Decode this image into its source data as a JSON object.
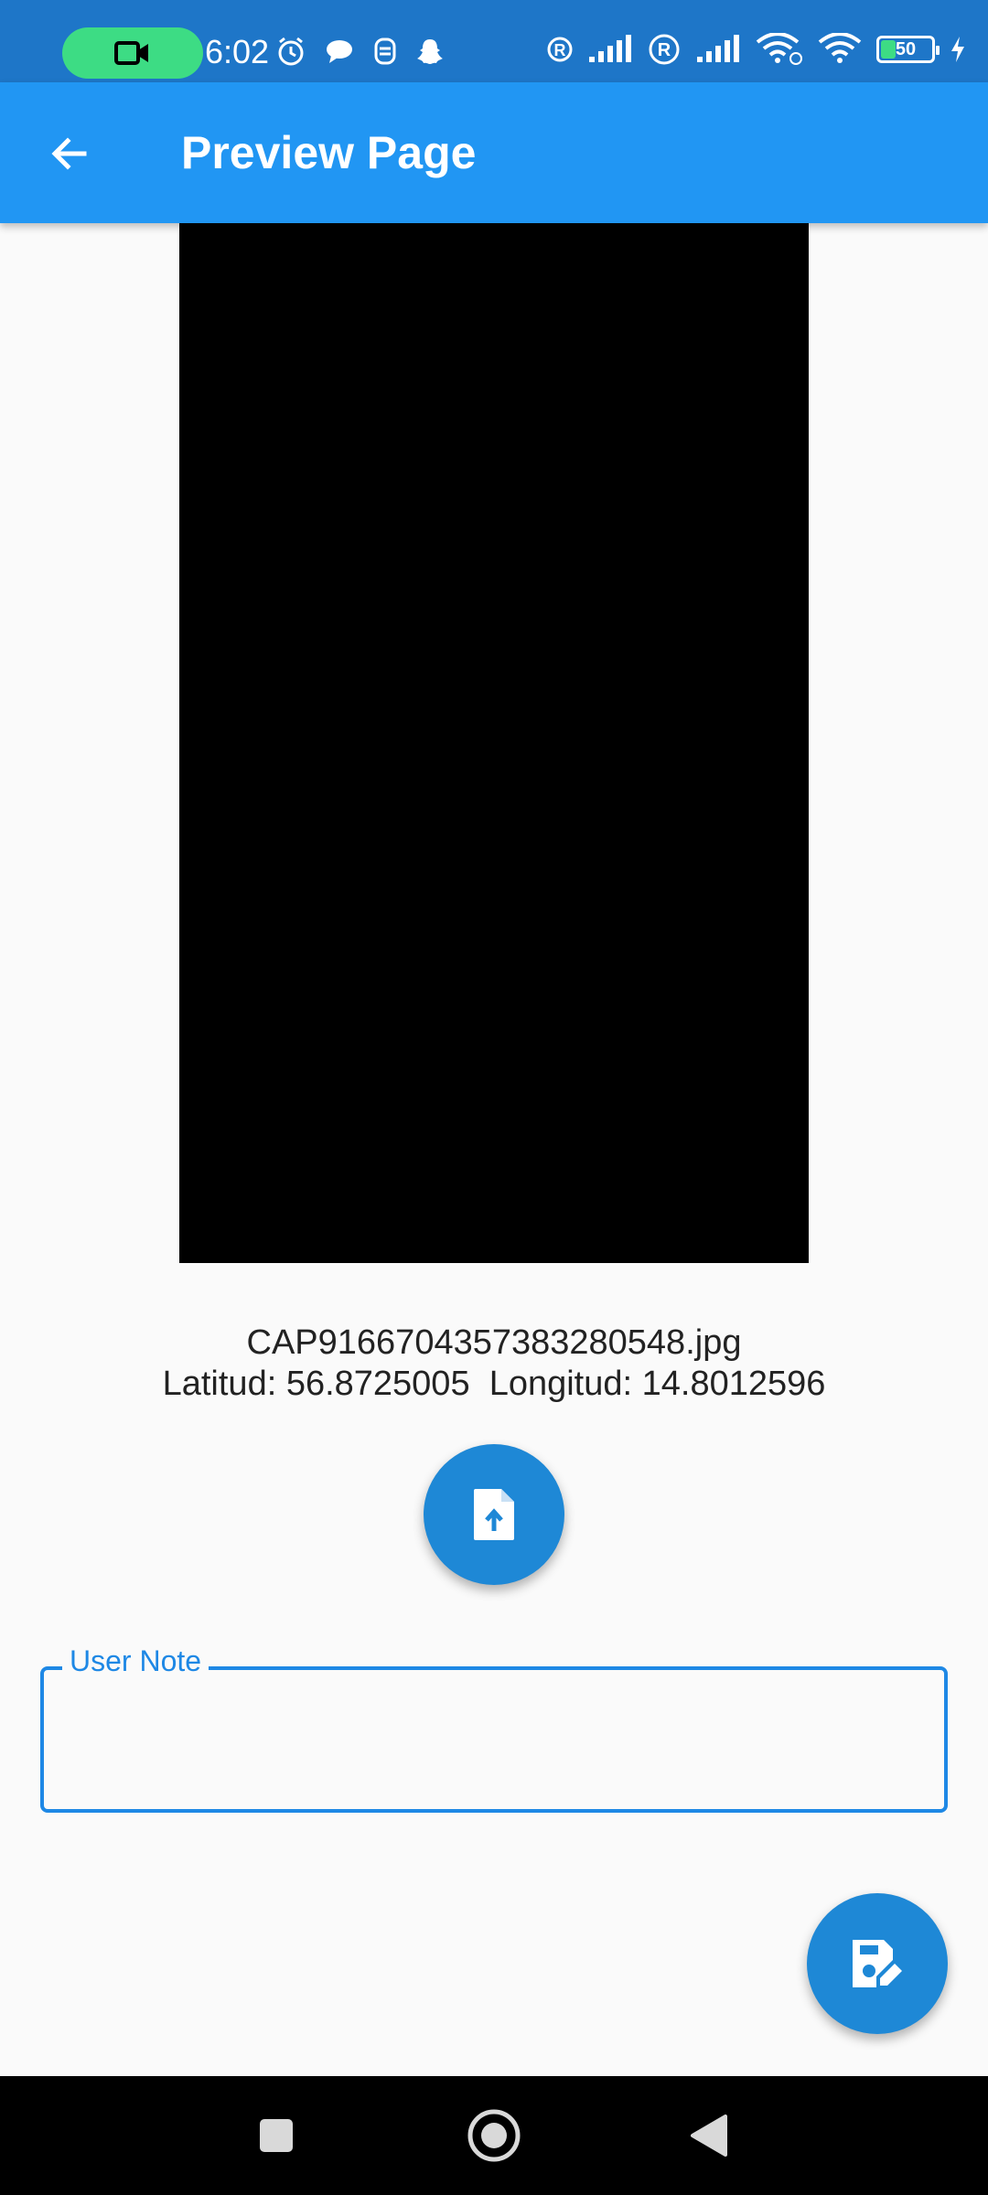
{
  "status_bar": {
    "time": "6:02",
    "battery_level": "50"
  },
  "app_bar": {
    "title": "Preview Page"
  },
  "file": {
    "name": "CAP9166704357383280548.jpg",
    "location": "Latitud: 56.8725005  Longitud: 14.8012596"
  },
  "note": {
    "label": "User Note",
    "value": ""
  },
  "icons": {
    "back": "arrow-back-icon",
    "upload": "file-upload-icon",
    "save": "save-edit-icon",
    "nav_recents": "square-icon",
    "nav_home": "circle-icon",
    "nav_back": "triangle-back-icon"
  },
  "colors": {
    "status_bar": "#1e76c8",
    "app_bar": "#2196f3",
    "fab": "#1e88d6",
    "accent": "#1e88e5",
    "recording_pill": "#3ddc84"
  }
}
